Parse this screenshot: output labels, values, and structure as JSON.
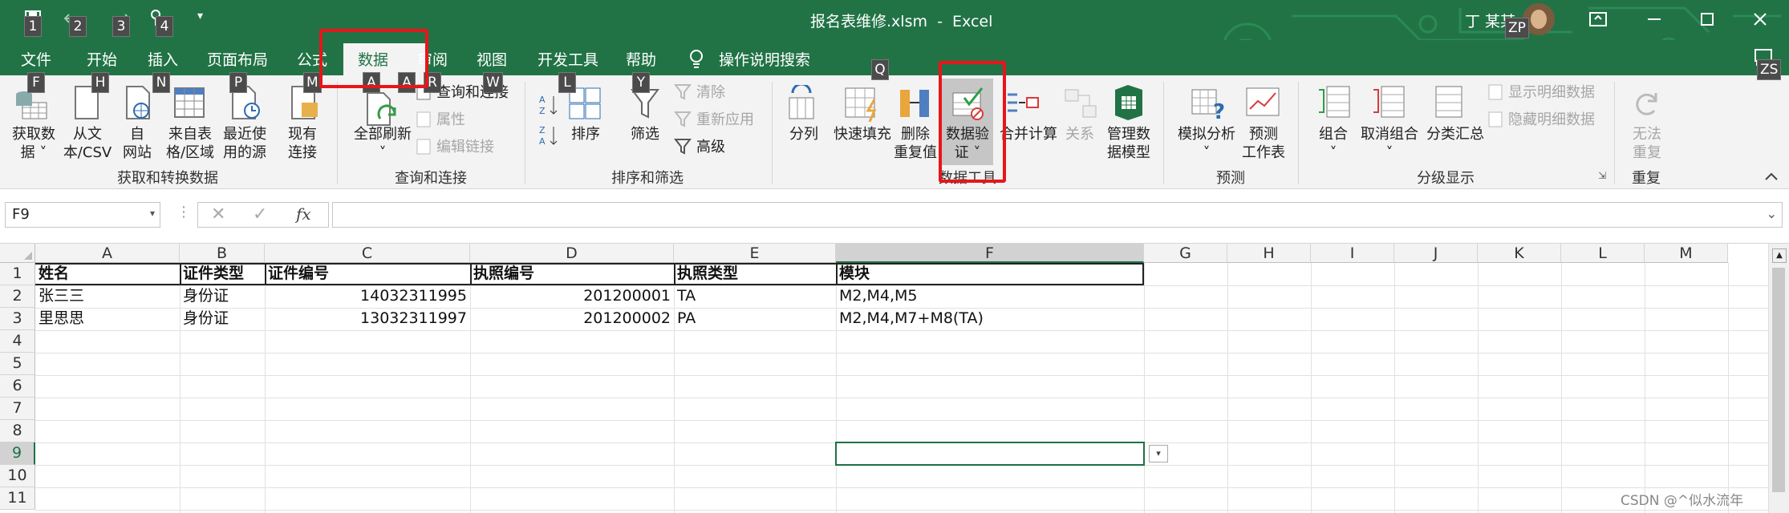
{
  "title": {
    "filename": "报名表维修.xlsm",
    "separator": "-",
    "app": "Excel",
    "user": "丁 某某",
    "user_initials": "ZP"
  },
  "qat_keytips": [
    "1",
    "2",
    "3",
    "4"
  ],
  "tabs": [
    {
      "label": "文件",
      "tip": "F"
    },
    {
      "label": "开始",
      "tip": "H"
    },
    {
      "label": "插入",
      "tip": "N"
    },
    {
      "label": "页面布局",
      "tip": "P"
    },
    {
      "label": "公式",
      "tip": "M"
    },
    {
      "label": "数据",
      "tip": "A"
    },
    {
      "label": "审阅",
      "tip": "R"
    },
    {
      "label": "视图",
      "tip": "W"
    },
    {
      "label": "开发工具",
      "tip": "L"
    },
    {
      "label": "帮助",
      "tip": "Y"
    },
    {
      "label": "操作说明搜索",
      "tip": "Q"
    }
  ],
  "tab_zs_tip": "ZS",
  "ribbon": {
    "get_data": [
      "获取数",
      "据"
    ],
    "from_csv": [
      "从文",
      "本/CSV"
    ],
    "from_web": [
      "自",
      "网站"
    ],
    "from_table": [
      "来自表",
      "格/区域"
    ],
    "recent": [
      "最近使",
      "用的源"
    ],
    "existing": [
      "现有",
      "连接"
    ],
    "refresh_all": "全部刷新",
    "queries": "查询和连接",
    "properties": "属性",
    "edit_links": "编辑链接",
    "sort": "排序",
    "filter": "筛选",
    "clear": "清除",
    "reapply": "重新应用",
    "advanced": "高级",
    "text_to_col": "分列",
    "flash_fill": "快速填充",
    "remove_dup": [
      "删除",
      "重复值"
    ],
    "data_validation": [
      "数据验",
      "证"
    ],
    "consolidate": "合并计算",
    "relationships": "关系",
    "manage_model": [
      "管理数",
      "据模型"
    ],
    "what_if": "模拟分析",
    "forecast": [
      "预测",
      "工作表"
    ],
    "group": "组合",
    "ungroup": "取消组合",
    "subtotal": "分类汇总",
    "show_detail": "显示明细数据",
    "hide_detail": "隐藏明细数据",
    "undo": [
      "无法",
      "重复"
    ],
    "groups": {
      "get": "获取和转换数据",
      "query": "查询和连接",
      "sort": "排序和筛选",
      "tools": "数据工具",
      "forecast": "预测",
      "outline": "分级显示",
      "repeat": "重复"
    }
  },
  "namebox": "F9",
  "formula": "",
  "fx": "fx",
  "columns": [
    "A",
    "B",
    "C",
    "D",
    "E",
    "F",
    "G",
    "H",
    "I",
    "J",
    "K",
    "L",
    "M"
  ],
  "rows": [
    "1",
    "2",
    "3",
    "4",
    "5",
    "6",
    "7",
    "8",
    "9",
    "10",
    "11"
  ],
  "header_row": [
    "姓名",
    "证件类型",
    "证件编号",
    "执照编号",
    "执照类型",
    "模块"
  ],
  "data_rows": [
    [
      "张三三",
      "身份证",
      "14032311995",
      "201200001",
      "TA",
      "M2,M4,M5"
    ],
    [
      "里思思",
      "身份证",
      "13032311997",
      "201200002",
      "PA",
      "M2,M4,M7+M8(TA)"
    ]
  ],
  "watermark": "CSDN @^似水流年",
  "colors": {
    "excel_green": "#217346",
    "highlight": "#e8151a",
    "selection": "#1e7145"
  }
}
